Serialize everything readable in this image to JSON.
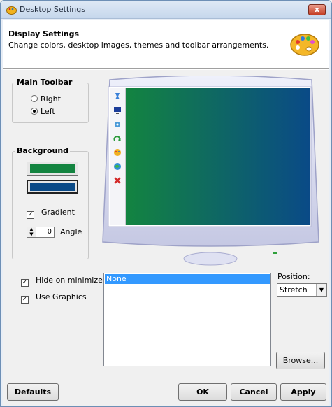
{
  "window": {
    "title": "Desktop Settings",
    "close_label": "x"
  },
  "header": {
    "title": "Display Settings",
    "subtitle": "Change colors, desktop images, themes and toolbar arrangements.",
    "icon": "palette-icon"
  },
  "main_toolbar": {
    "label": "Main Toolbar",
    "options": [
      {
        "label": "Right",
        "selected": false
      },
      {
        "label": "Left",
        "selected": true
      }
    ]
  },
  "background": {
    "label": "Background",
    "color1": "#138440",
    "color2": "#0a4a87",
    "gradient_label": "Gradient",
    "gradient_checked": true,
    "angle_value": "0",
    "angle_label": "Angle"
  },
  "preview": {
    "toolbar_icons": [
      "pin-icon",
      "monitor-icon",
      "gear-icon",
      "refresh-icon",
      "paint-icon",
      "globe-icon",
      "close-icon"
    ]
  },
  "options": {
    "hide_on_minimize": {
      "label": "Hide on minimize",
      "checked": true
    },
    "use_graphics": {
      "label": "Use Graphics",
      "checked": true
    }
  },
  "images": {
    "items": [
      "None"
    ],
    "selected": "None"
  },
  "position": {
    "label": "Position:",
    "value": "Stretch"
  },
  "buttons": {
    "browse": "Browse...",
    "defaults": "Defaults",
    "ok": "OK",
    "cancel": "Cancel",
    "apply": "Apply"
  }
}
